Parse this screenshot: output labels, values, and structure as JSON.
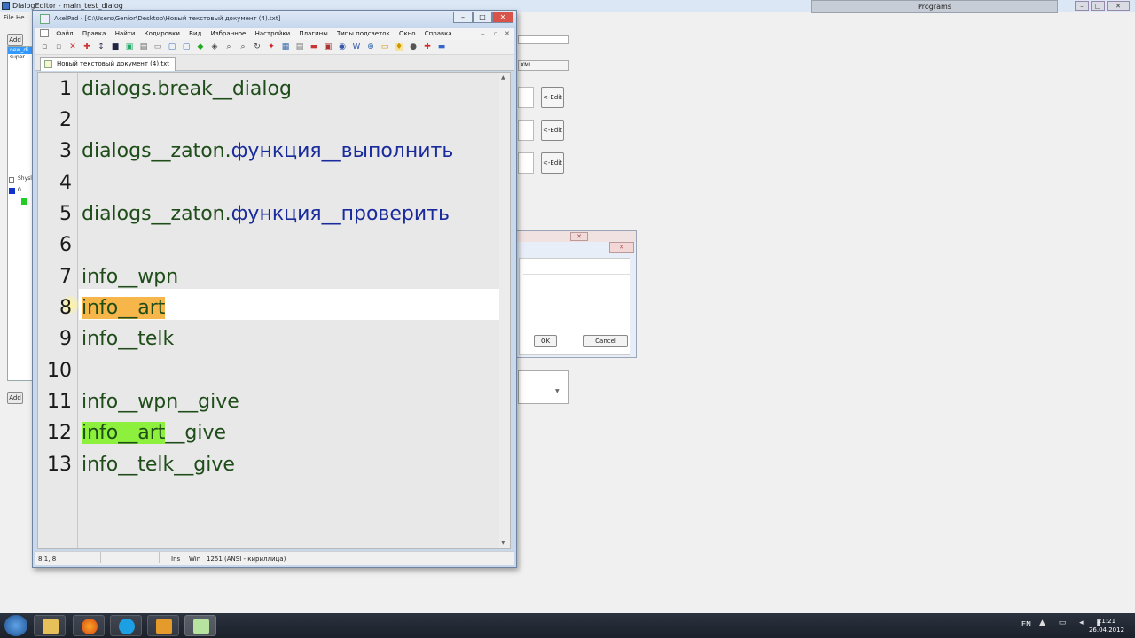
{
  "background": {
    "title": "DialogEditor - main_test_dialog",
    "menu": [
      "File",
      "He"
    ],
    "add_label": "Add",
    "add_label2": "Add",
    "list_items": [
      "new_di",
      "super"
    ],
    "tree_label": "Shysl",
    "tree_node": "0",
    "xml_label": "XML",
    "edit_buttons": [
      "<-Edit",
      "<-Edit",
      "<-Edit"
    ],
    "programs_label": "Programs",
    "window_controls": {
      "min": "–",
      "max": "□",
      "close": "✕"
    }
  },
  "small_dialog": {
    "ok_label": "OK",
    "cancel_label": "Cancel",
    "close_glyph": "✕",
    "close_glyph2": "✕"
  },
  "akelpad": {
    "title": "AkelPad - [C:\\Users\\Genior\\Desktop\\Новый текстовый документ (4).txt]",
    "window_controls": {
      "min": "–",
      "max": "□",
      "close": "✕"
    },
    "menu": [
      "Файл",
      "Правка",
      "Найти",
      "Кодировки",
      "Вид",
      "Избранное",
      "Настройки",
      "Плагины",
      "Типы подсветок",
      "Окно",
      "Справка"
    ],
    "menu_controls": {
      "min": "–",
      "max": "▫",
      "close": "✕"
    },
    "tab_label": "Новый текстовый документ (4).txt",
    "editor": {
      "line_numbers": [
        "1",
        "2",
        "3",
        "4",
        "5",
        "6",
        "7",
        "8",
        "9",
        "10",
        "11",
        "12",
        "13"
      ],
      "lines": {
        "l1": "dialogs.break__dialog",
        "l3a": "dialogs__zaton.",
        "l3b": "функция__выполнить",
        "l5a": "dialogs__zaton.",
        "l5b": "функция__проверить",
        "l7": "info__wpn",
        "l8": "info__art",
        "l9": "info__telk",
        "l11": "info__wpn__give",
        "l12a": "info__art",
        "l12b": "__give",
        "l13": "info__telk__give"
      },
      "scroll_up": "▲",
      "scroll_down": "▼"
    },
    "status": {
      "position": "8:1, 8",
      "mode": "Ins",
      "line_ending": "Win",
      "encoding": "1251  (ANSI - кириллица)"
    }
  },
  "taskbar": {
    "language": "EN",
    "tray_icons": "▲ ▭ ◂ ▮",
    "time": "21:21",
    "date": "26.04.2012"
  },
  "colors": {
    "keyword_green": "#1f4d1a",
    "function_blue": "#1a2b9c",
    "highlight_orange": "#f7b64a",
    "highlight_green": "#8cf03c"
  }
}
